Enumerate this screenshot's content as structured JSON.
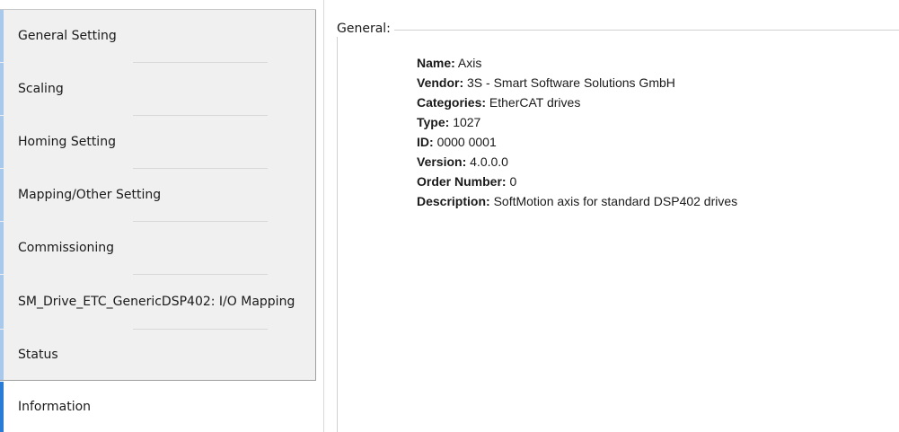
{
  "sidebar": {
    "items": [
      {
        "label": "General Setting"
      },
      {
        "label": "Scaling"
      },
      {
        "label": "Homing Setting"
      },
      {
        "label": "Mapping/Other Setting"
      },
      {
        "label": "Commissioning"
      },
      {
        "label": "SM_Drive_ETC_GenericDSP402: I/O Mapping"
      },
      {
        "label": "Status"
      },
      {
        "label": "Information"
      }
    ],
    "active_index": 7,
    "accent_color": "#a8c8ec",
    "active_accent_color": "#2a7bd6"
  },
  "content": {
    "group_title": "General:",
    "fields": [
      {
        "key": "Name:",
        "value": "Axis"
      },
      {
        "key": "Vendor:",
        "value": "3S - Smart Software Solutions GmbH"
      },
      {
        "key": "Categories:",
        "value": "EtherCAT drives"
      },
      {
        "key": "Type:",
        "value": "1027"
      },
      {
        "key": "ID:",
        "value": "0000 0001"
      },
      {
        "key": "Version:",
        "value": "4.0.0.0"
      },
      {
        "key": "Order Number:",
        "value": "0"
      },
      {
        "key": "Description:",
        "value": "SoftMotion axis for standard DSP402 drives"
      }
    ]
  }
}
